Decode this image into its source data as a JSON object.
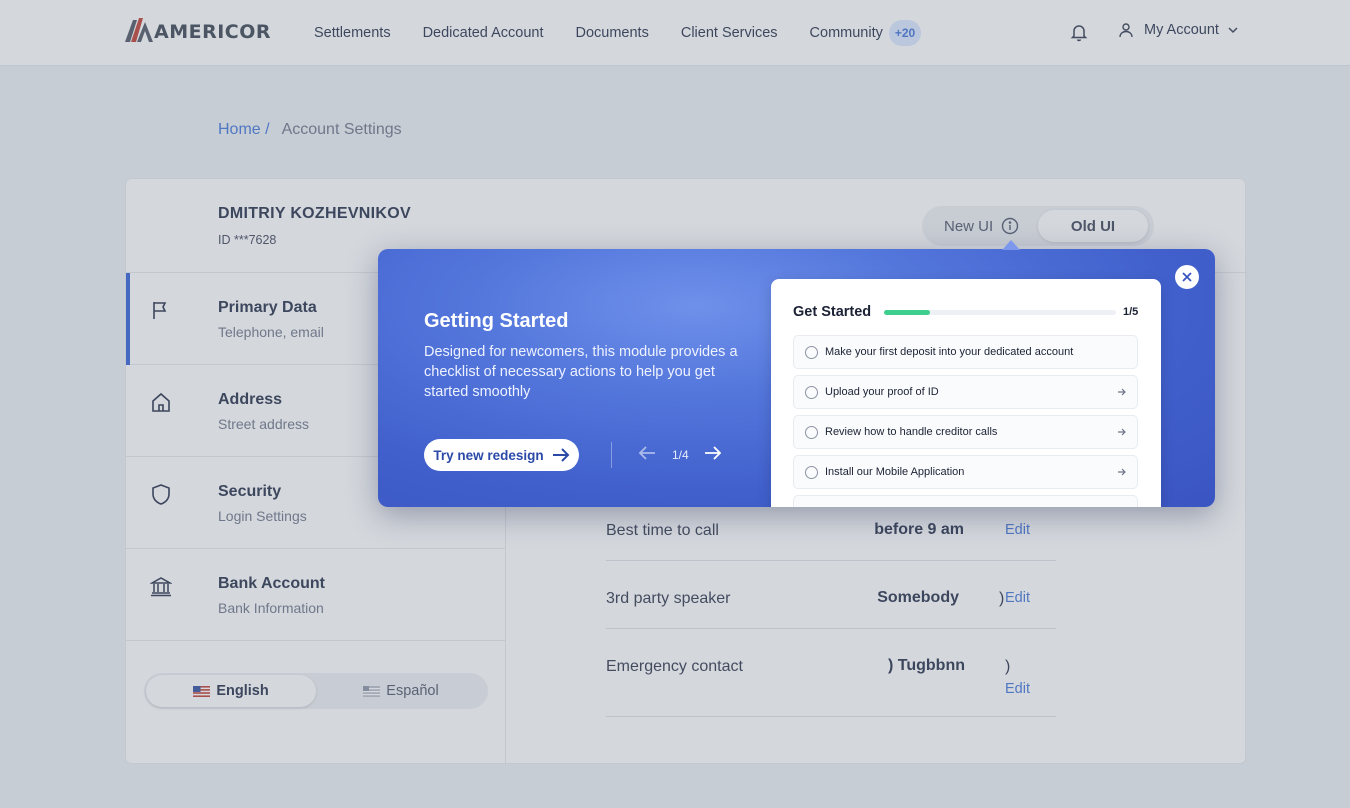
{
  "header": {
    "logo_text": "AMERICOR",
    "nav": [
      {
        "label": "Settlements"
      },
      {
        "label": "Dedicated Account"
      },
      {
        "label": "Documents"
      },
      {
        "label": "Client Services"
      },
      {
        "label": "Community",
        "badge": "+20"
      }
    ],
    "account_label": "My Account",
    "icons": {
      "bell": "bell-icon",
      "user": "user-icon",
      "chevron": "chevron-down-icon"
    }
  },
  "breadcrumb": {
    "home": "Home /",
    "current": "Account Settings"
  },
  "user": {
    "name": "DMITRIY KOZHEVNIKOV",
    "id": "ID ***7628"
  },
  "ui_toggle": {
    "new_label": "New UI",
    "old_label": "Old UI"
  },
  "sidebar": {
    "items": [
      {
        "title": "Primary Data",
        "subtitle": "Telephone, email",
        "icon": "flag-icon"
      },
      {
        "title": "Address",
        "subtitle": "Street address",
        "icon": "home-icon"
      },
      {
        "title": "Security",
        "subtitle": "Login Settings",
        "icon": "shield-icon"
      },
      {
        "title": "Bank Account",
        "subtitle": "Bank Information",
        "icon": "bank-icon"
      }
    ]
  },
  "language": {
    "english": "English",
    "spanish": "Español"
  },
  "fields": [
    {
      "label": "Best time to call",
      "value": "before 9 am",
      "edit": "Edit"
    },
    {
      "label": "3rd party speaker",
      "value": "Somebody",
      "paren": ")",
      "edit": "Edit"
    },
    {
      "label": "Emergency contact",
      "value": ") Tugbbnn",
      "paren": ")",
      "edit": "Edit"
    }
  ],
  "popover": {
    "title": "Getting Started",
    "description": "Designed for newcomers, this module provides a checklist of necessary actions to help you get started smoothly",
    "button": "Try new redesign",
    "pager": "1/4",
    "preview": {
      "title": "Get Started",
      "count": "1/5",
      "progress": 0.2,
      "items": [
        "Make your first deposit into your dedicated account",
        "Upload your proof of ID",
        "Review how to handle creditor calls",
        "Install our Mobile Application"
      ]
    }
  },
  "colors": {
    "accent": "#2a5fd6",
    "link": "#3b72d9",
    "progress": "#3ecf8e"
  }
}
